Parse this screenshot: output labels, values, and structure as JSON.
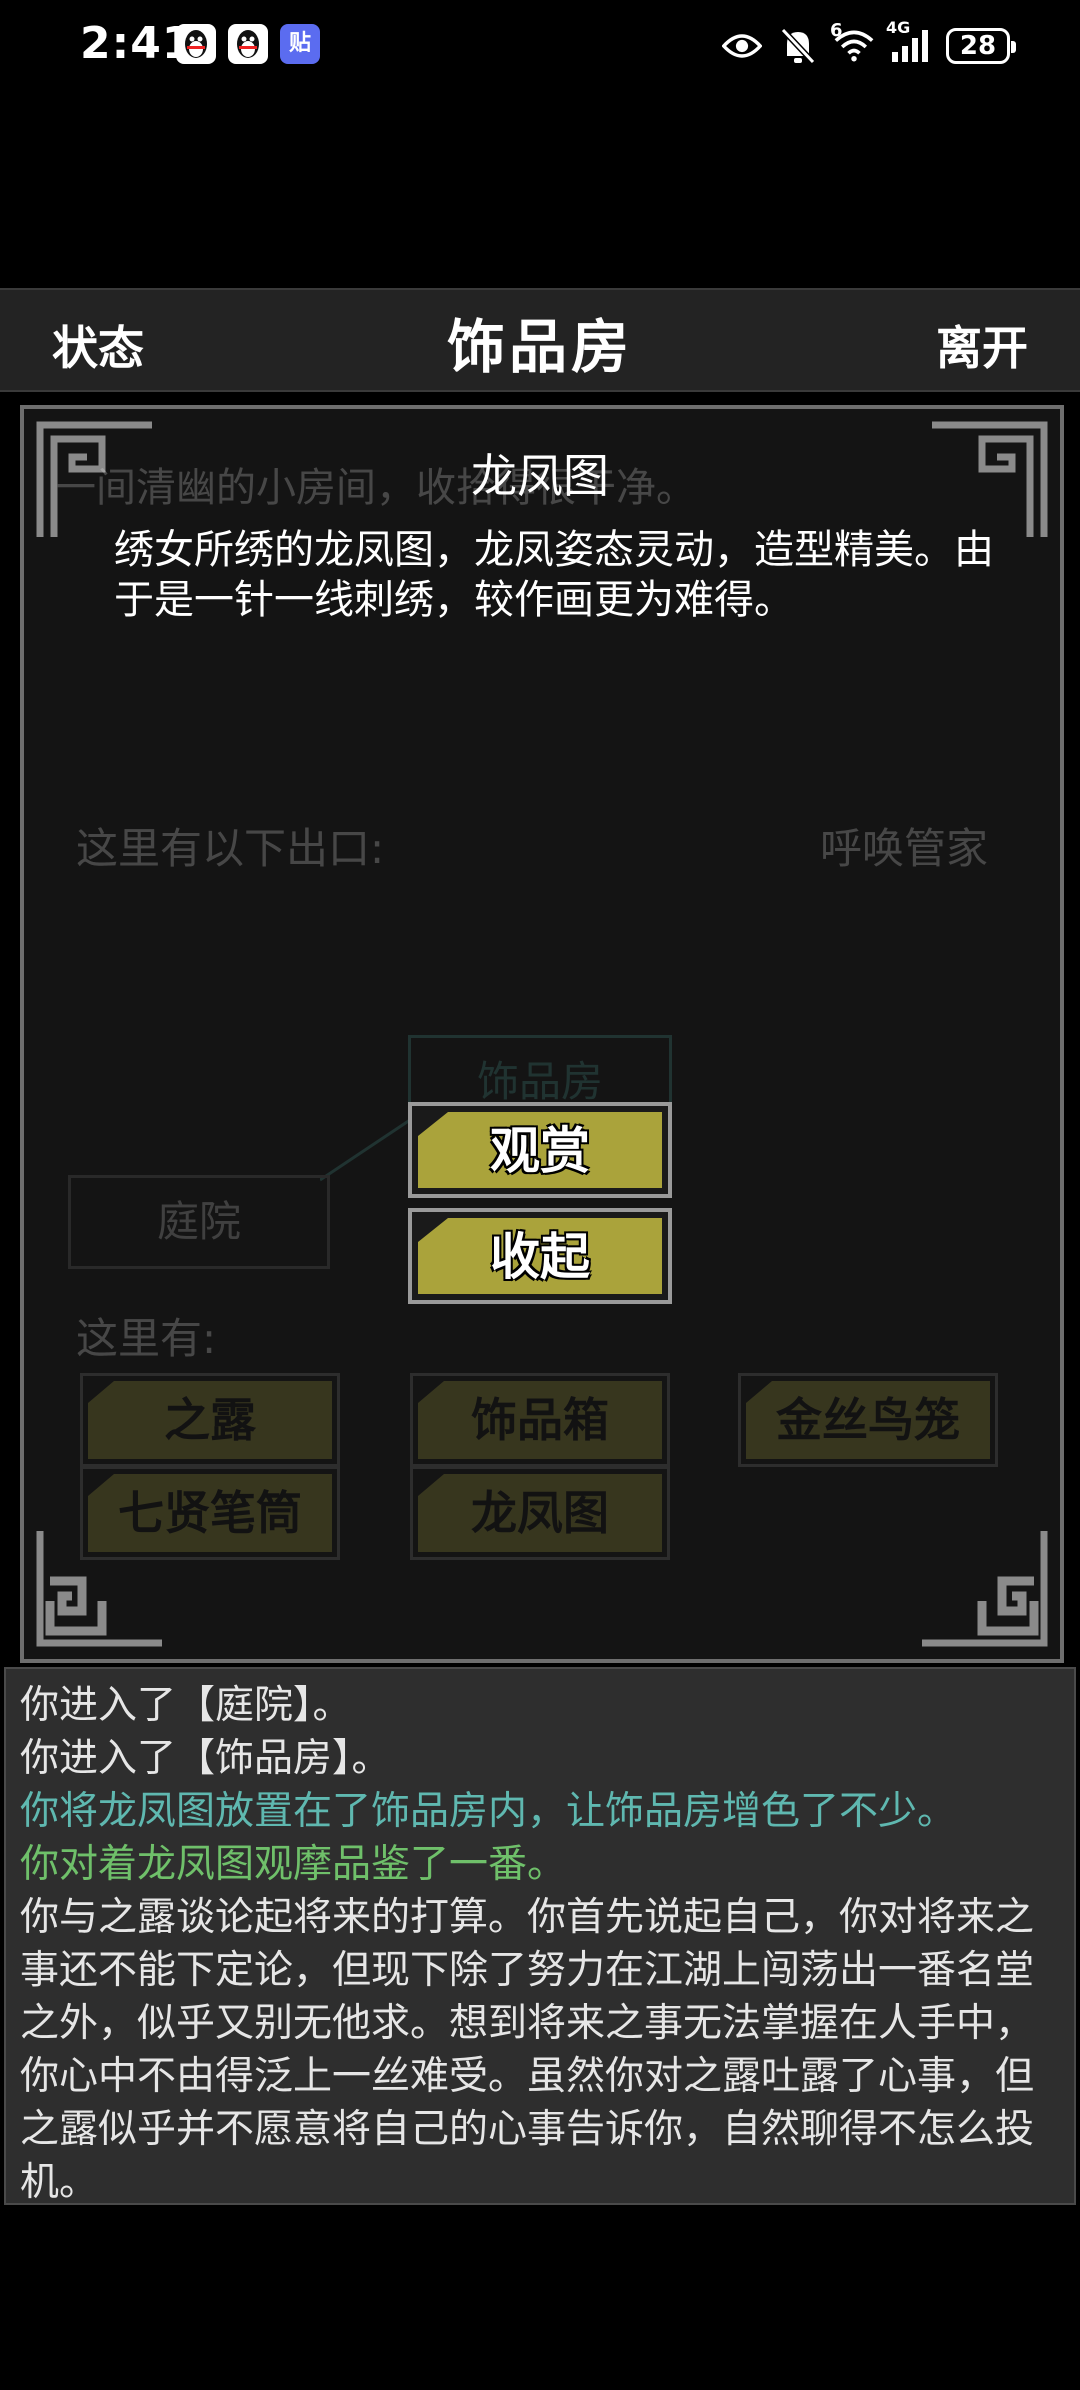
{
  "status_bar": {
    "time": "2:41",
    "notification_apps": [
      "qq-icon",
      "qq-icon",
      "tieba-icon"
    ],
    "tieba_label": "贴",
    "network": "4G",
    "wifi_superscript": "6",
    "battery": "28"
  },
  "header": {
    "left": "状态",
    "title": "饰品房",
    "right": "离开"
  },
  "room": {
    "description": "一间清幽的小房间，收拾得很干净。",
    "exits_label": "这里有以下出口:",
    "summon_label": "呼唤管家",
    "map_current": "饰品房",
    "map_exit": "庭院",
    "here_label": "这里有:",
    "items": [
      "之露",
      "饰品箱",
      "金丝鸟笼",
      "七贤笔筒",
      "龙凤图"
    ]
  },
  "dialog": {
    "title": "龙凤图",
    "description": "绣女所绣的龙凤图，龙凤姿态灵动，造型精美。由于是一针一线刺绣，较作画更为难得。",
    "actions": [
      "观赏",
      "收起"
    ]
  },
  "log": [
    {
      "text": "你进入了【庭院】。",
      "color": "#e6e6e6"
    },
    {
      "text": "你进入了【饰品房】。",
      "color": "#e6e6e6"
    },
    {
      "text": "你将龙凤图放置在了饰品房内，让饰品房增色了不少。",
      "color": "#5fb8b0"
    },
    {
      "text": "你对着龙凤图观摩品鉴了一番。",
      "color": "#6fc06a"
    },
    {
      "text": "你与之露谈论起将来的打算。你首先说起自己，你对将来之事还不能下定论，但现下除了努力在江湖上闯荡出一番名堂之外，似乎又别无他求。想到将来之事无法掌握在人手中，你心中不由得泛上一丝难受。虽然你对之露吐露了心事，但之露似乎并不愿意将自己的心事告诉你，自然聊得不怎么投机。",
      "color": "#e6e6e6"
    }
  ]
}
